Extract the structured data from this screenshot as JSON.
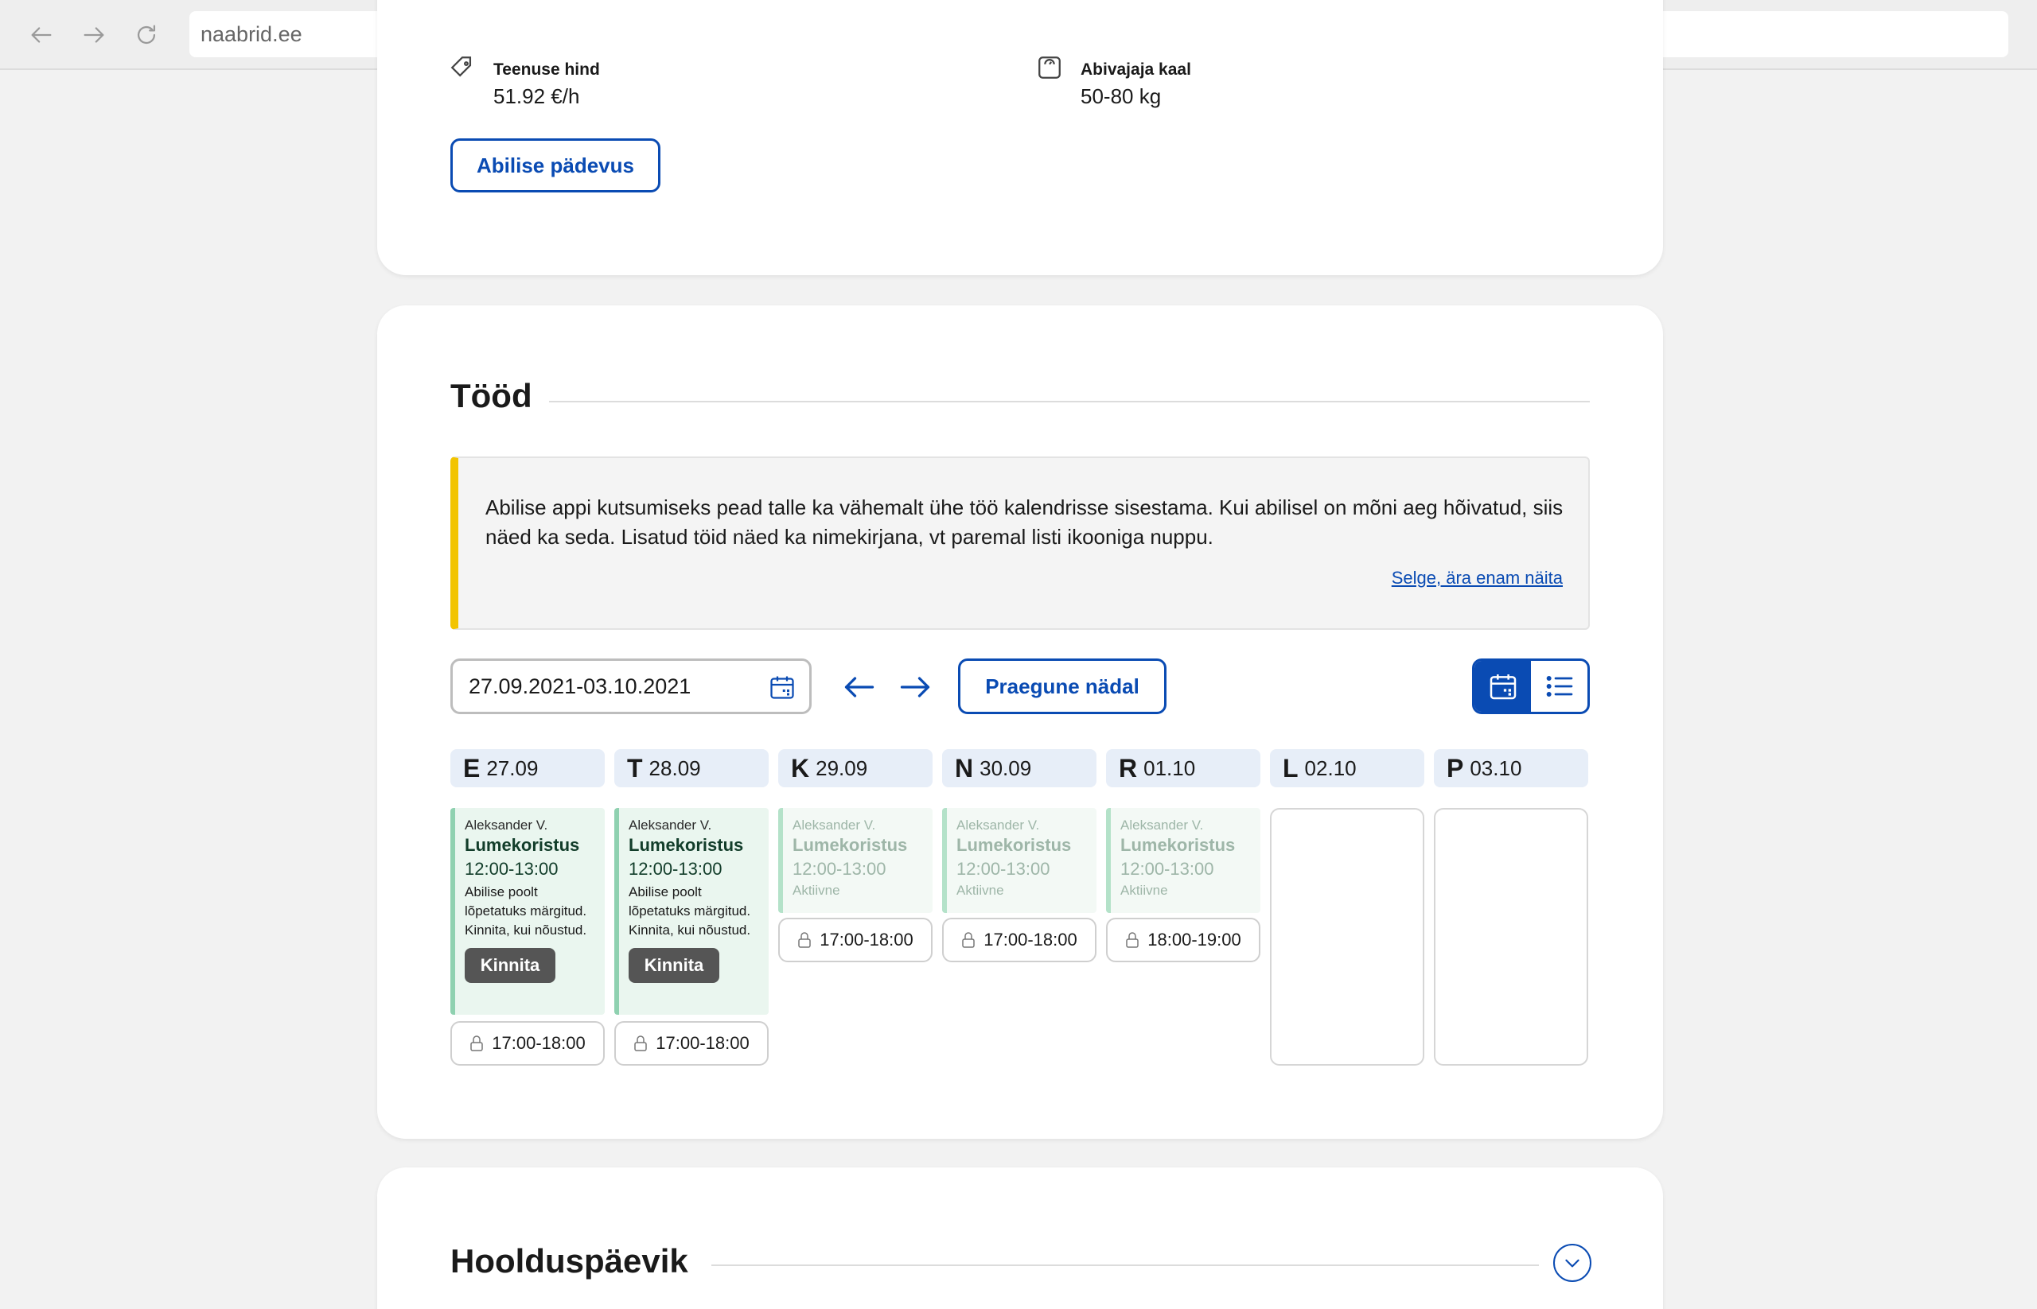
{
  "browser": {
    "url": "naabrid.ee"
  },
  "details": {
    "price_label": "Teenuse hind",
    "price_value": "51.92 €/h",
    "weight_label": "Abivajaja kaal",
    "weight_value": "50-80 kg",
    "competence_button": "Abilise pädevus"
  },
  "jobs": {
    "title": "Tööd",
    "notice_text": "Abilise appi kutsumiseks pead talle ka vähemalt ühe töö kalendrisse sisestama. Kui abilisel on mõni aeg hõivatud, siis näed ka seda. Lisatud töid näed ka nimekirjana, vt paremal listi ikooniga nuppu.",
    "notice_dismiss": "Selge, ära enam näita",
    "date_range": "27.09.2021-03.10.2021",
    "current_week_button": "Praegune nädal",
    "days": [
      {
        "letter": "E",
        "date": "27.09",
        "helper": "Aleksander V.",
        "service": "Lumekoristus",
        "time": "12:00-13:00",
        "note": "Abilise poolt lõpetatuks märgitud. Kinnita, kui nõustud.",
        "confirm": "Kinnita",
        "slot": "17:00-18:00"
      },
      {
        "letter": "T",
        "date": "28.09",
        "helper": "Aleksander V.",
        "service": "Lumekoristus",
        "time": "12:00-13:00",
        "note": "Abilise poolt lõpetatuks märgitud. Kinnita, kui nõustud.",
        "confirm": "Kinnita",
        "slot": "17:00-18:00"
      },
      {
        "letter": "K",
        "date": "29.09",
        "helper": "Aleksander V.",
        "service": "Lumekoristus",
        "time": "12:00-13:00",
        "status": "Aktiivne",
        "slot": "17:00-18:00"
      },
      {
        "letter": "N",
        "date": "30.09",
        "helper": "Aleksander V.",
        "service": "Lumekoristus",
        "time": "12:00-13:00",
        "status": "Aktiivne",
        "slot": "17:00-18:00"
      },
      {
        "letter": "R",
        "date": "01.10",
        "helper": "Aleksander V.",
        "service": "Lumekoristus",
        "time": "12:00-13:00",
        "status": "Aktiivne",
        "slot": "18:00-19:00"
      },
      {
        "letter": "L",
        "date": "02.10"
      },
      {
        "letter": "P",
        "date": "03.10"
      }
    ]
  },
  "diary": {
    "title": "Hoolduspäevik"
  },
  "icons": {
    "back": "arrow-left-icon",
    "forward": "arrow-right-icon",
    "reload": "reload-icon",
    "price": "tag-icon",
    "weight": "scale-icon",
    "calendar": "calendar-icon",
    "list": "list-icon",
    "lock": "lock-icon",
    "expand": "chevron-down-icon"
  },
  "colors": {
    "accent": "#0a4bb3",
    "notice_bar": "#f2c400",
    "event_bg": "#eaf6ef",
    "event_border": "#8fd1b0"
  }
}
